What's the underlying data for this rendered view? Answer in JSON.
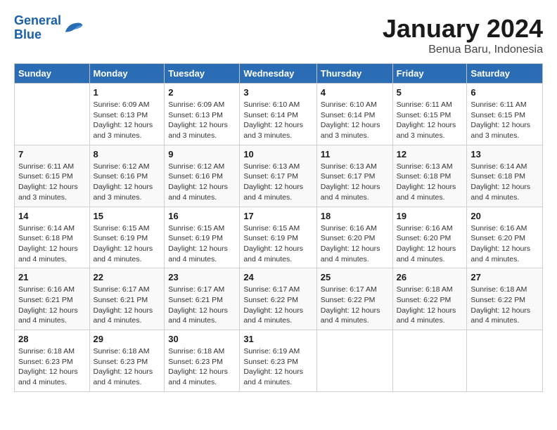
{
  "logo": {
    "line1": "General",
    "line2": "Blue"
  },
  "title": "January 2024",
  "subtitle": "Benua Baru, Indonesia",
  "days_of_week": [
    "Sunday",
    "Monday",
    "Tuesday",
    "Wednesday",
    "Thursday",
    "Friday",
    "Saturday"
  ],
  "weeks": [
    [
      {
        "day": "",
        "info": ""
      },
      {
        "day": "1",
        "info": "Sunrise: 6:09 AM\nSunset: 6:13 PM\nDaylight: 12 hours\nand 3 minutes."
      },
      {
        "day": "2",
        "info": "Sunrise: 6:09 AM\nSunset: 6:13 PM\nDaylight: 12 hours\nand 3 minutes."
      },
      {
        "day": "3",
        "info": "Sunrise: 6:10 AM\nSunset: 6:14 PM\nDaylight: 12 hours\nand 3 minutes."
      },
      {
        "day": "4",
        "info": "Sunrise: 6:10 AM\nSunset: 6:14 PM\nDaylight: 12 hours\nand 3 minutes."
      },
      {
        "day": "5",
        "info": "Sunrise: 6:11 AM\nSunset: 6:15 PM\nDaylight: 12 hours\nand 3 minutes."
      },
      {
        "day": "6",
        "info": "Sunrise: 6:11 AM\nSunset: 6:15 PM\nDaylight: 12 hours\nand 3 minutes."
      }
    ],
    [
      {
        "day": "7",
        "info": "Sunrise: 6:11 AM\nSunset: 6:15 PM\nDaylight: 12 hours\nand 3 minutes."
      },
      {
        "day": "8",
        "info": "Sunrise: 6:12 AM\nSunset: 6:16 PM\nDaylight: 12 hours\nand 3 minutes."
      },
      {
        "day": "9",
        "info": "Sunrise: 6:12 AM\nSunset: 6:16 PM\nDaylight: 12 hours\nand 4 minutes."
      },
      {
        "day": "10",
        "info": "Sunrise: 6:13 AM\nSunset: 6:17 PM\nDaylight: 12 hours\nand 4 minutes."
      },
      {
        "day": "11",
        "info": "Sunrise: 6:13 AM\nSunset: 6:17 PM\nDaylight: 12 hours\nand 4 minutes."
      },
      {
        "day": "12",
        "info": "Sunrise: 6:13 AM\nSunset: 6:18 PM\nDaylight: 12 hours\nand 4 minutes."
      },
      {
        "day": "13",
        "info": "Sunrise: 6:14 AM\nSunset: 6:18 PM\nDaylight: 12 hours\nand 4 minutes."
      }
    ],
    [
      {
        "day": "14",
        "info": "Sunrise: 6:14 AM\nSunset: 6:18 PM\nDaylight: 12 hours\nand 4 minutes."
      },
      {
        "day": "15",
        "info": "Sunrise: 6:15 AM\nSunset: 6:19 PM\nDaylight: 12 hours\nand 4 minutes."
      },
      {
        "day": "16",
        "info": "Sunrise: 6:15 AM\nSunset: 6:19 PM\nDaylight: 12 hours\nand 4 minutes."
      },
      {
        "day": "17",
        "info": "Sunrise: 6:15 AM\nSunset: 6:19 PM\nDaylight: 12 hours\nand 4 minutes."
      },
      {
        "day": "18",
        "info": "Sunrise: 6:16 AM\nSunset: 6:20 PM\nDaylight: 12 hours\nand 4 minutes."
      },
      {
        "day": "19",
        "info": "Sunrise: 6:16 AM\nSunset: 6:20 PM\nDaylight: 12 hours\nand 4 minutes."
      },
      {
        "day": "20",
        "info": "Sunrise: 6:16 AM\nSunset: 6:20 PM\nDaylight: 12 hours\nand 4 minutes."
      }
    ],
    [
      {
        "day": "21",
        "info": "Sunrise: 6:16 AM\nSunset: 6:21 PM\nDaylight: 12 hours\nand 4 minutes."
      },
      {
        "day": "22",
        "info": "Sunrise: 6:17 AM\nSunset: 6:21 PM\nDaylight: 12 hours\nand 4 minutes."
      },
      {
        "day": "23",
        "info": "Sunrise: 6:17 AM\nSunset: 6:21 PM\nDaylight: 12 hours\nand 4 minutes."
      },
      {
        "day": "24",
        "info": "Sunrise: 6:17 AM\nSunset: 6:22 PM\nDaylight: 12 hours\nand 4 minutes."
      },
      {
        "day": "25",
        "info": "Sunrise: 6:17 AM\nSunset: 6:22 PM\nDaylight: 12 hours\nand 4 minutes."
      },
      {
        "day": "26",
        "info": "Sunrise: 6:18 AM\nSunset: 6:22 PM\nDaylight: 12 hours\nand 4 minutes."
      },
      {
        "day": "27",
        "info": "Sunrise: 6:18 AM\nSunset: 6:22 PM\nDaylight: 12 hours\nand 4 minutes."
      }
    ],
    [
      {
        "day": "28",
        "info": "Sunrise: 6:18 AM\nSunset: 6:23 PM\nDaylight: 12 hours\nand 4 minutes."
      },
      {
        "day": "29",
        "info": "Sunrise: 6:18 AM\nSunset: 6:23 PM\nDaylight: 12 hours\nand 4 minutes."
      },
      {
        "day": "30",
        "info": "Sunrise: 6:18 AM\nSunset: 6:23 PM\nDaylight: 12 hours\nand 4 minutes."
      },
      {
        "day": "31",
        "info": "Sunrise: 6:19 AM\nSunset: 6:23 PM\nDaylight: 12 hours\nand 4 minutes."
      },
      {
        "day": "",
        "info": ""
      },
      {
        "day": "",
        "info": ""
      },
      {
        "day": "",
        "info": ""
      }
    ]
  ]
}
